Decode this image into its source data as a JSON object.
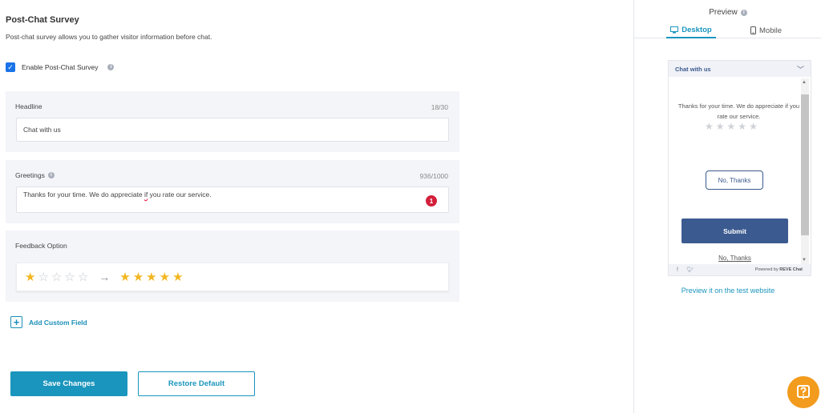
{
  "page": {
    "title": "Post-Chat Survey",
    "subtitle": "Post-chat survey allows you to gather visitor information before chat."
  },
  "enable": {
    "label": "Enable Post-Chat Survey",
    "checked": true
  },
  "headline": {
    "label": "Headline",
    "count": "18/30",
    "value": "Chat with us"
  },
  "greetings": {
    "label": "Greetings",
    "count": "936/1000",
    "value_before": "Thanks for your time. We do appreciate ",
    "value_misspelled": "if",
    "value_after": " you rate our service.",
    "error_count": "1"
  },
  "feedback": {
    "label": "Feedback Option",
    "from_rating": 1,
    "to_rating": 5,
    "max_rating": 5
  },
  "add_custom_field": "Add Custom Field",
  "buttons": {
    "save": "Save Changes",
    "restore": "Restore Default"
  },
  "preview": {
    "title": "Preview",
    "tabs": [
      {
        "label": "Desktop",
        "active": true
      },
      {
        "label": "Mobile",
        "active": false
      }
    ],
    "widget": {
      "header": "Chat with us",
      "message": "Thanks for your time. We do appreciate if you rate our service.",
      "no_thanks_button": "No, Thanks",
      "submit": "Submit",
      "no_thanks_link": "No, Thanks",
      "powered_by": "Powered by",
      "brand": "REVE Chat"
    },
    "link": "Preview it on the test website"
  },
  "colors": {
    "accent": "#1a95bd",
    "widget_primary": "#3b5a8f",
    "star": "#f2b61f",
    "help": "#f29b1d",
    "error": "#d31f3a"
  }
}
